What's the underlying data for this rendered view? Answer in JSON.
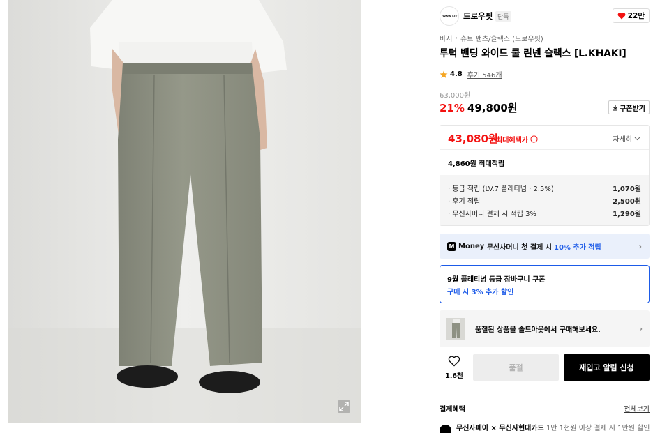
{
  "brand": {
    "logo_text": "DRAW FIT",
    "name": "드로우핏",
    "tag": "단독"
  },
  "likes": "22만",
  "breadcrumb": [
    "바지",
    "슈트 팬츠/슬랙스 (드로우핏)"
  ],
  "product": {
    "title": "투턱 밴딩 와이드 쿨 린넨 슬랙스 [L.KHAKI]"
  },
  "rating": {
    "score": "4.8",
    "reviews": "후기 546개"
  },
  "price": {
    "original": "63,000원",
    "discount": "21%",
    "sale": "49,800원",
    "coupon_button": "쿠폰받기"
  },
  "benefit": {
    "max_price": "43,080원",
    "max_label": "최대혜택가",
    "detail_toggle": "자세히",
    "points_total": "4,860원 최대적립",
    "points": [
      {
        "label": "· 등급 적립 (LV.7 플래티넘 · 2.5%)",
        "amount": "1,070원"
      },
      {
        "label": "· 후기 적립",
        "amount": "2,500원"
      },
      {
        "label": "· 무신사머니 결제 시 적립 3%",
        "amount": "1,290원"
      }
    ]
  },
  "money_banner": {
    "logo": "M",
    "brand": "Money",
    "text": "무신사머니 첫 결제 시",
    "highlight": "10% 추가 적립"
  },
  "coupon_card": {
    "title": "9월 플래티넘 등급 장바구니 쿠폰",
    "subtitle": "구매 시 3% 추가 할인"
  },
  "soldout_banner": {
    "text": "품절된 상품을 솔드아웃에서 구매해보세요."
  },
  "actions": {
    "wish_count": "1.6천",
    "soldout_label": "품절",
    "restock_label": "재입고 알림 신청"
  },
  "payment": {
    "heading": "결제혜택",
    "view_all": "전체보기",
    "row": {
      "title": "무신사페이 × 무신사현대카드",
      "desc": "1만 1천원 이상 결제 시 1만원 할인"
    }
  },
  "colors": {
    "accent_red": "#f31110",
    "accent_blue": "#1d5be8",
    "pants": "#8e9183",
    "wall": "#e9e9e7"
  }
}
